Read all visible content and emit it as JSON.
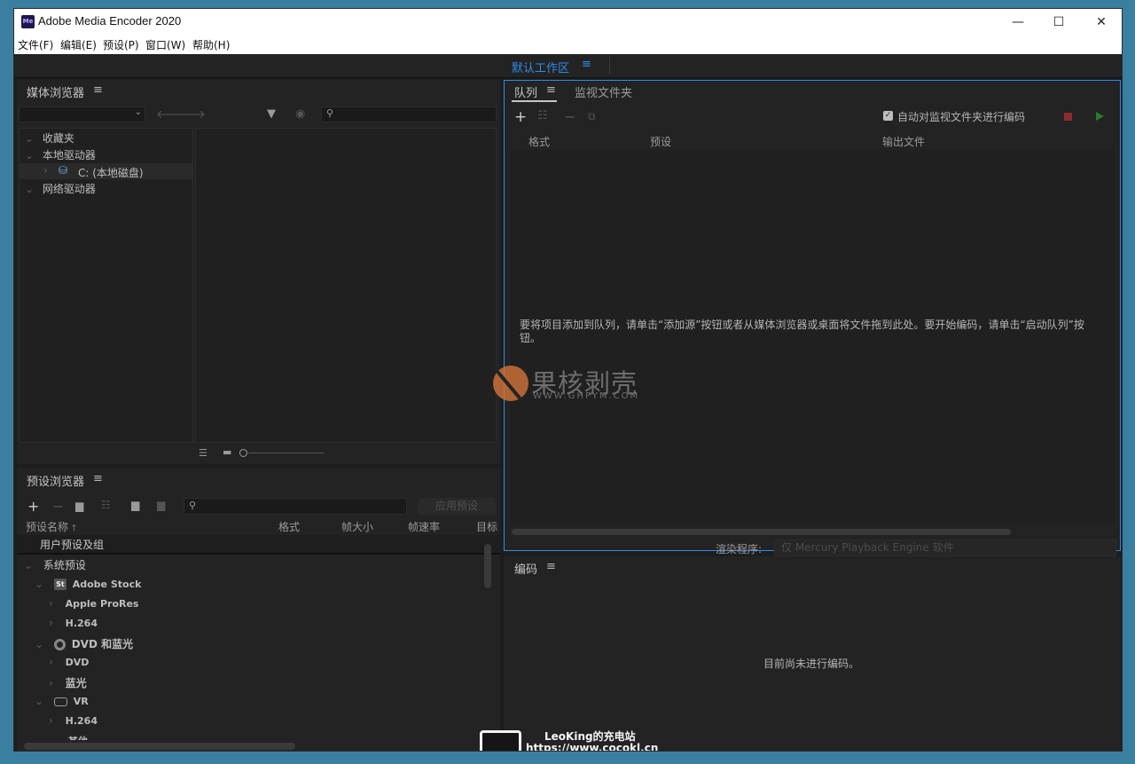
{
  "window": {
    "app_icon_text": "Me",
    "title": "Adobe Media Encoder 2020",
    "minimize": "—",
    "maximize": "☐",
    "close": "✕"
  },
  "menu": [
    "文件(F)",
    "编辑(E)",
    "预设(P)",
    "窗口(W)",
    "帮助(H)"
  ],
  "workspace": {
    "label": "默认工作区",
    "menu_icon": "≡"
  },
  "media_browser": {
    "title": "媒体浏览器",
    "menu_icon": "≡",
    "tree": {
      "favorites": "收藏夹",
      "local_drives": "本地驱动器",
      "c_drive": "C: (本地磁盘)",
      "network_drives": "网络驱动器"
    }
  },
  "preset_browser": {
    "title": "预设浏览器",
    "menu_icon": "≡",
    "apply_button": "应用预设",
    "columns": [
      "预设名称",
      "格式",
      "帧大小",
      "帧速率",
      "目标"
    ],
    "user_group": "用户预设及组",
    "system_group": "系统预设",
    "items": [
      {
        "label": "Adobe Stock",
        "badge": "St",
        "level": 1,
        "expanded": true
      },
      {
        "label": "Apple ProRes",
        "level": 2
      },
      {
        "label": "H.264",
        "level": 2
      },
      {
        "label": "DVD 和蓝光",
        "badge": "disc",
        "level": 1,
        "expanded": true
      },
      {
        "label": "DVD",
        "level": 2
      },
      {
        "label": "蓝光",
        "level": 2
      },
      {
        "label": "VR",
        "badge": "vr",
        "level": 1,
        "expanded": true
      },
      {
        "label": "H.264",
        "level": 2
      },
      {
        "label": "其他",
        "level": 1
      }
    ]
  },
  "queue": {
    "tab_queue": "队列",
    "tab_watch": "监视文件夹",
    "menu_icon": "≡",
    "auto_encode_label": "自动对监视文件夹进行编码",
    "auto_encode_checked": true,
    "columns": [
      "格式",
      "预设",
      "输出文件"
    ],
    "empty_message": "要将项目添加到队列，请单击“添加源”按钮或者从媒体浏览器或桌面将文件拖到此处。要开始编码，请单击“启动队列”按钮。",
    "renderer_label": "渲染程序:",
    "renderer_value": "仅 Mercury Playback Engine 软件"
  },
  "encoding": {
    "title": "编码",
    "menu_icon": "≡",
    "status": "目前尚未进行编码。"
  },
  "watermark": {
    "text": "果核剥壳",
    "url": "WWW.GHPYM.COM"
  },
  "footer": {
    "line1": "LeoKing的充电站",
    "line2": "https://www.cocokl.cn"
  },
  "colors": {
    "accent": "#2d8ceb",
    "panel": "#232323",
    "stop": "#8c2b2b",
    "play": "#2b7a2b"
  }
}
